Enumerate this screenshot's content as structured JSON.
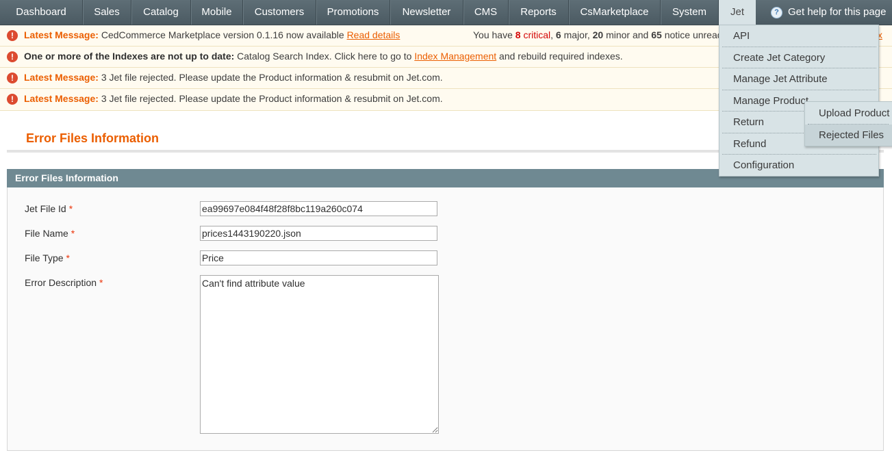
{
  "nav": {
    "items": [
      "Dashboard",
      "Sales",
      "Catalog",
      "Mobile",
      "Customers",
      "Promotions",
      "Newsletter",
      "CMS",
      "Reports",
      "CsMarketplace",
      "System",
      "Jet"
    ],
    "help_label": "Get help for this page",
    "help_icon": "help-circle-icon"
  },
  "messages": {
    "m1": {
      "prefix": "Latest Message:",
      "text": " CedCommerce Marketplace version 0.1.16 now available ",
      "link": "Read details",
      "summary": {
        "pre": "You have ",
        "critical_count": "8",
        "critical_label": " critical",
        "sep1": ", ",
        "major_count": "6",
        "major_label": " major, ",
        "minor_count": "20",
        "minor_label": " minor and ",
        "notice_count": "65",
        "notice_label": " notice unread message(s). "
      },
      "tail_link": "x"
    },
    "m2": {
      "prefix": "One or more of the Indexes are not up to date:",
      "text": " Catalog Search Index. Click here to go to ",
      "link": "Index Management",
      "suffix": " and rebuild required indexes."
    },
    "m3": {
      "prefix": "Latest Message:",
      "text": " 3 Jet file rejected. Please update the Product information & resubmit on Jet.com."
    },
    "m4": {
      "prefix": "Latest Message:",
      "text": " 3 Jet file rejected. Please update the Product information & resubmit on Jet.com."
    },
    "icon": "!"
  },
  "page": {
    "title": "Error Files Information",
    "section_title": "Error Files Information"
  },
  "form": {
    "jet_file_id": {
      "label": "Jet File Id",
      "value": "ea99697e084f48f28f8bc119a260c074"
    },
    "file_name": {
      "label": "File Name",
      "value": "prices1443190220.json"
    },
    "file_type": {
      "label": "File Type",
      "value": "Price"
    },
    "error_description": {
      "label": "Error Description",
      "value": "Can't find attribute value"
    },
    "required_mark": "*"
  },
  "jet_menu": {
    "items": [
      "API",
      "Create Jet Category",
      "Manage Jet Attribute",
      "Manage Product",
      "Return",
      "Refund",
      "Configuration"
    ],
    "submenu": [
      "Upload Product",
      "Rejected Files"
    ]
  },
  "colors": {
    "nav_bg": "#4f5f67",
    "accent_orange": "#eb5e00",
    "section_header": "#6f8992",
    "menu_bg": "#d8e3e6",
    "message_bg": "#fffbf0"
  }
}
